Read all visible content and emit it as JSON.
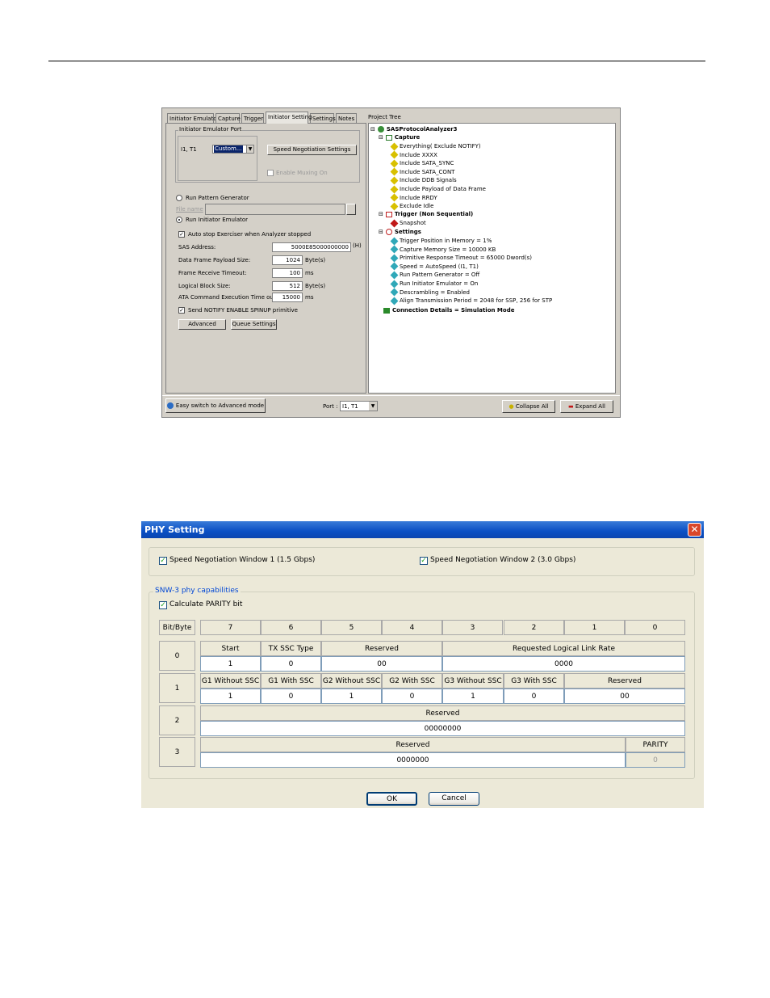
{
  "shot1": {
    "tabs": [
      "Initiator Emulator",
      "Capture",
      "Trigger",
      "Initiator Setting",
      "Settings",
      "Notes"
    ],
    "active_tab": "Initiator Setting",
    "project_tree_label": "Project Tree",
    "emulator_port_group": "Initiator Emulator Port",
    "port_label": "I1, T1",
    "port_select": "Custom...",
    "speed_negotiation_button": "Speed Negotiation Settings",
    "enable_muxing_label": "Enable Muxing On",
    "run_pattern_generator": "Run Pattern Generator",
    "filename_label": "File name",
    "run_initiator_emulator": "Run Initiator Emulator",
    "auto_stop_label": "Auto stop  Exerciser when Analyzer stopped",
    "sas_address_label": "SAS Address:",
    "sas_address_value": "5000E85000000000",
    "sas_address_unit": "(H)",
    "payload_label": "Data Frame Payload Size:",
    "payload_value": "1024",
    "payload_unit": "Byte(s)",
    "frame_timeout_label": "Frame Receive Timeout:",
    "frame_timeout_value": "100",
    "frame_timeout_unit": "ms",
    "block_size_label": "Logical Block Size:",
    "block_size_value": "512",
    "block_size_unit": "Byte(s)",
    "ata_timeout_label": "ATA Command Execution Time out:",
    "ata_timeout_value": "15000",
    "ata_timeout_unit": "ms",
    "send_notify_label": "Send NOTIFY ENABLE SPINUP primitive",
    "advanced_button": "Advanced",
    "queue_button": "Queue Settings",
    "easy_switch_button": "Easy switch to Advanced mode",
    "bottom_port_label": "Port :",
    "bottom_port_value": "I1, T1",
    "collapse_button": "Collapse All",
    "expand_button": "Expand All",
    "tree": {
      "root": "SASProtocolAnalyzer3",
      "capture": "Capture",
      "capture_items": [
        "Everything( Exclude NOTIFY)",
        "Include XXXX",
        "Include SATA_SYNC",
        "Include SATA_CONT",
        "Include DDB Signals",
        "Include Payload of Data Frame",
        "Include RRDY",
        "Exclude Idle"
      ],
      "trigger": "Trigger (Non Sequential)",
      "trigger_items": [
        "Snapshot"
      ],
      "settings": "Settings",
      "settings_items": [
        "Trigger Position in Memory = 1%",
        "Capture Memory Size = 10000 KB",
        "Primitive Response Timeout = 65000 Dword(s)",
        "Speed = AutoSpeed (I1, T1)",
        "Run Pattern Generator = Off",
        "Run Initiator Emulator = On",
        "Descrambling = Enabled",
        "Align Transmission Period = 2048 for SSP, 256 for STP"
      ],
      "connection": "Connection Details = Simulation Mode"
    }
  },
  "shot2": {
    "title": "PHY Setting",
    "snw1": "Speed Negotiation Window 1 (1.5 Gbps)",
    "snw2": "Speed Negotiation Window 2 (3.0 Gbps)",
    "group_label": "SNW-3 phy capabilities",
    "calc_parity": "Calculate PARITY bit",
    "header": {
      "corner": "Bit/Byte",
      "bits": [
        "7",
        "6",
        "5",
        "4",
        "3",
        "2",
        "1",
        "0"
      ]
    },
    "bytes": [
      "0",
      "1",
      "2",
      "3"
    ],
    "row0": {
      "labels": [
        "Start",
        "TX SSC Type",
        "Reserved",
        "Requested Logical Link Rate"
      ],
      "values": [
        "1",
        "0",
        "00",
        "0000"
      ]
    },
    "row1": {
      "labels": [
        "G1 Without SSC",
        "G1 With SSC",
        "G2 Without SSC",
        "G2 With SSC",
        "G3 Without SSC",
        "G3 With SSC",
        "Reserved"
      ],
      "values": [
        "1",
        "0",
        "1",
        "0",
        "1",
        "0",
        "00"
      ]
    },
    "row2": {
      "label": "Reserved",
      "value": "00000000"
    },
    "row3": {
      "label": "Reserved",
      "value": "0000000",
      "parity_label": "PARITY",
      "parity_value": "0"
    },
    "ok": "OK",
    "cancel": "Cancel"
  },
  "colors": {
    "xp_title": "#0a4fc4",
    "win_gray": "#d4d0c8",
    "xp_face": "#ece9d8"
  }
}
